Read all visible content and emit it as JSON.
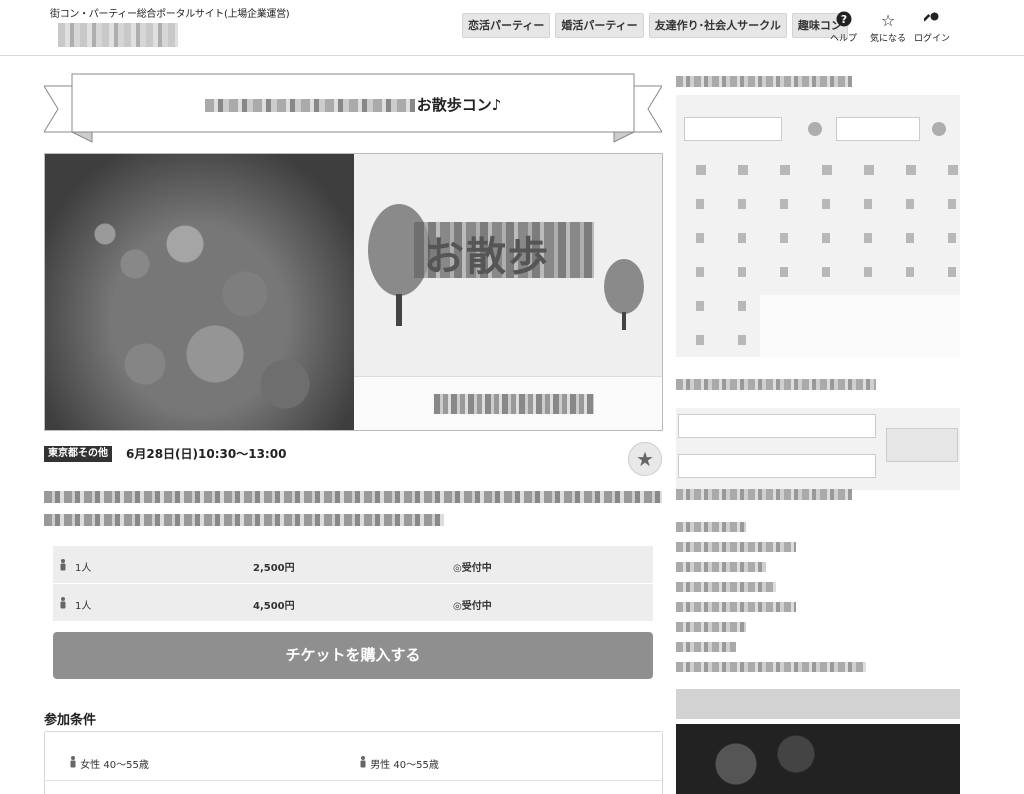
{
  "header": {
    "tagline": "街コン・パーティー総合ポータルサイト(上場企業運営)",
    "nav": [
      {
        "label": "恋活パーティー"
      },
      {
        "label": "婚活パーティー"
      },
      {
        "label": "友達作り･社会人サークル"
      },
      {
        "label": "趣味コン"
      }
    ],
    "help_label": "ヘルプ",
    "favorite_label": "気になる",
    "login_label": "ログイン"
  },
  "event": {
    "title_suffix": "お散歩コン♪",
    "area_badge": "東京都その他",
    "date": "6月28日(日)10:30～13:00"
  },
  "tickets": [
    {
      "count": "1人",
      "price": "2,500円",
      "status": "◎受付中"
    },
    {
      "count": "1人",
      "price": "4,500円",
      "status": "◎受付中"
    }
  ],
  "buy_button": "チケットを購入する",
  "conditions": {
    "title": "参加条件",
    "female": "女性 40～55歳",
    "male": "男性 40～55歳"
  },
  "hero_text": "お散歩"
}
